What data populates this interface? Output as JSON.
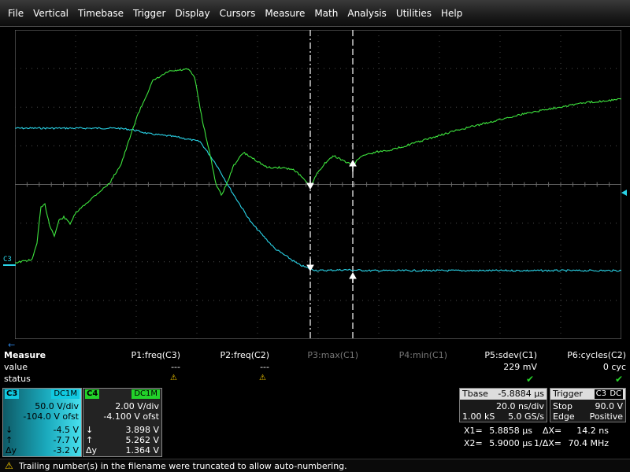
{
  "menu": [
    "File",
    "Vertical",
    "Timebase",
    "Trigger",
    "Display",
    "Cursors",
    "Measure",
    "Math",
    "Analysis",
    "Utilities",
    "Help"
  ],
  "colors": {
    "c3": "#2ad4e8",
    "c4": "#3ee43e",
    "grid": "#5a5a5a",
    "warn": "#f3c800",
    "ok": "#27d62a"
  },
  "left_marker_label": "C3",
  "measure": {
    "title": "Measure",
    "row_value_label": "value",
    "row_status_label": "status",
    "params": [
      {
        "name": "P1:freq(C3)",
        "value": "---",
        "status": "warn"
      },
      {
        "name": "P2:freq(C2)",
        "value": "---",
        "status": "warn"
      },
      {
        "name": "P3:max(C1)",
        "value": "",
        "status": ""
      },
      {
        "name": "P4:min(C1)",
        "value": "",
        "status": ""
      },
      {
        "name": "P5:sdev(C1)",
        "value": "229 mV",
        "status": "ok"
      },
      {
        "name": "P6:cycles(C2)",
        "value": "0 cyc",
        "status": "ok"
      }
    ]
  },
  "ch3": {
    "tag": "C3",
    "coupling": "DC1M",
    "vdiv": "50.0 V/div",
    "offset": "-104.0 V ofst",
    "down_sym": "↓",
    "down": "-4.5 V",
    "up_sym": "↑",
    "up": "-7.7 V",
    "dy_sym": "Δy",
    "dy": "-3.2 V"
  },
  "ch4": {
    "tag": "C4",
    "coupling": "DC1M",
    "vdiv": "2.00 V/div",
    "offset": "-4.100 V ofst",
    "down_sym": "↓",
    "down": "3.898 V",
    "up_sym": "↑",
    "up": "5.262 V",
    "dy_sym": "Δy",
    "dy": "1.364 V"
  },
  "timebase": {
    "label": "Tbase",
    "delay": "-5.8884 µs",
    "tdiv": "20.0 ns/div",
    "samples": "1.00 kS",
    "rate": "5.0 GS/s"
  },
  "trigger": {
    "label": "Trigger",
    "source": "C3",
    "coupling": "DC",
    "mode_label": "Stop",
    "level": "90.0 V",
    "type_label": "Edge",
    "slope": "Positive"
  },
  "cursors": {
    "x1_label": "X1=",
    "x1": "5.8858 µs",
    "dx_label": "ΔX=",
    "dx": "14.2 ns",
    "x2_label": "X2=",
    "x2": "5.9000 µs",
    "inv_dx_label": "1/ΔX=",
    "inv_dx": "70.4 MHz"
  },
  "status_message": "Trailing number(s) in the filename were truncated to allow auto-numbering."
}
